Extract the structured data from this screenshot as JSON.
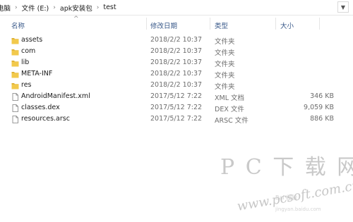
{
  "breadcrumb": [
    "电脑",
    "文件 (E:)",
    "apk安装包",
    "test"
  ],
  "columns": {
    "name": "名称",
    "date": "修改日期",
    "type": "类型",
    "size": "大小"
  },
  "files": [
    {
      "name": "assets",
      "date": "2018/2/2 10:37",
      "type": "文件夹",
      "size": "",
      "icon": "folder-icon"
    },
    {
      "name": "com",
      "date": "2018/2/2 10:37",
      "type": "文件夹",
      "size": "",
      "icon": "folder-icon"
    },
    {
      "name": "lib",
      "date": "2018/2/2 10:37",
      "type": "文件夹",
      "size": "",
      "icon": "folder-icon"
    },
    {
      "name": "META-INF",
      "date": "2018/2/2 10:37",
      "type": "文件夹",
      "size": "",
      "icon": "folder-icon"
    },
    {
      "name": "res",
      "date": "2018/2/2 10:37",
      "type": "文件夹",
      "size": "",
      "icon": "folder-icon"
    },
    {
      "name": "AndroidManifest.xml",
      "date": "2017/5/12 7:22",
      "type": "XML 文档",
      "size": "346 KB",
      "icon": "file-icon"
    },
    {
      "name": "classes.dex",
      "date": "2017/5/12 7:22",
      "type": "DEX 文件",
      "size": "9,059 KB",
      "icon": "file-icon"
    },
    {
      "name": "resources.arsc",
      "date": "2017/5/12 7:22",
      "type": "ARSC 文件",
      "size": "886 KB",
      "icon": "file-icon"
    }
  ],
  "watermark": {
    "brand": "P C 下 载 网",
    "url": "www.pcsoft.com.cn",
    "sub": "Bai 经验",
    "sub2": "jingyan.baidu.com"
  },
  "colors": {
    "folder": "#f2c94c",
    "folder_dark": "#dcae2e",
    "header_text": "#3a5a8a"
  }
}
